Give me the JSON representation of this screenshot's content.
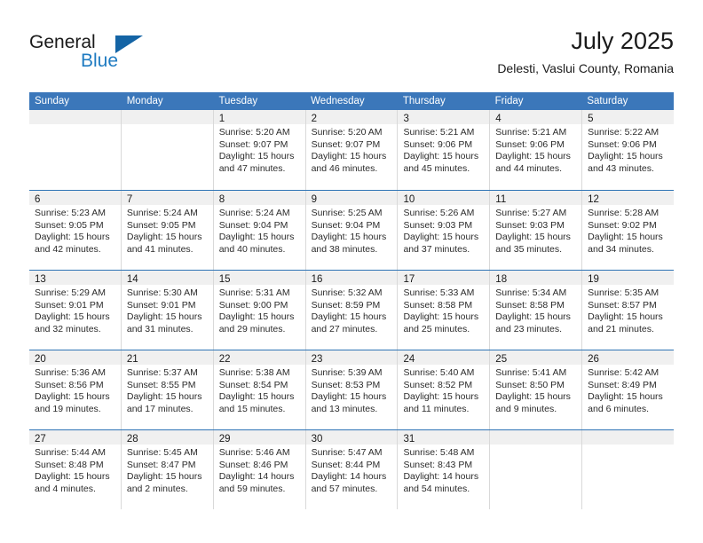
{
  "brand": {
    "name_part1": "General",
    "name_part2": "Blue",
    "logo_icon": "triangle-icon",
    "accent_blue": "#1f7bc1",
    "triangle_blue": "#1464a5"
  },
  "header": {
    "title": "July 2025",
    "subtitle": "Delesti, Vaslui County, Romania"
  },
  "calendar": {
    "header_bg": "#3b77ba",
    "row_separator_color": "#2f74b5",
    "day_band_bg": "#f0f0f0",
    "weekdays": [
      "Sunday",
      "Monday",
      "Tuesday",
      "Wednesday",
      "Thursday",
      "Friday",
      "Saturday"
    ],
    "weeks": [
      [
        {
          "day": "",
          "empty": true,
          "lines": []
        },
        {
          "day": "",
          "empty": true,
          "lines": []
        },
        {
          "day": "1",
          "empty": false,
          "lines": [
            "Sunrise: 5:20 AM",
            "Sunset: 9:07 PM",
            "Daylight: 15 hours",
            "and 47 minutes."
          ]
        },
        {
          "day": "2",
          "empty": false,
          "lines": [
            "Sunrise: 5:20 AM",
            "Sunset: 9:07 PM",
            "Daylight: 15 hours",
            "and 46 minutes."
          ]
        },
        {
          "day": "3",
          "empty": false,
          "lines": [
            "Sunrise: 5:21 AM",
            "Sunset: 9:06 PM",
            "Daylight: 15 hours",
            "and 45 minutes."
          ]
        },
        {
          "day": "4",
          "empty": false,
          "lines": [
            "Sunrise: 5:21 AM",
            "Sunset: 9:06 PM",
            "Daylight: 15 hours",
            "and 44 minutes."
          ]
        },
        {
          "day": "5",
          "empty": false,
          "lines": [
            "Sunrise: 5:22 AM",
            "Sunset: 9:06 PM",
            "Daylight: 15 hours",
            "and 43 minutes."
          ]
        }
      ],
      [
        {
          "day": "6",
          "empty": false,
          "lines": [
            "Sunrise: 5:23 AM",
            "Sunset: 9:05 PM",
            "Daylight: 15 hours",
            "and 42 minutes."
          ]
        },
        {
          "day": "7",
          "empty": false,
          "lines": [
            "Sunrise: 5:24 AM",
            "Sunset: 9:05 PM",
            "Daylight: 15 hours",
            "and 41 minutes."
          ]
        },
        {
          "day": "8",
          "empty": false,
          "lines": [
            "Sunrise: 5:24 AM",
            "Sunset: 9:04 PM",
            "Daylight: 15 hours",
            "and 40 minutes."
          ]
        },
        {
          "day": "9",
          "empty": false,
          "lines": [
            "Sunrise: 5:25 AM",
            "Sunset: 9:04 PM",
            "Daylight: 15 hours",
            "and 38 minutes."
          ]
        },
        {
          "day": "10",
          "empty": false,
          "lines": [
            "Sunrise: 5:26 AM",
            "Sunset: 9:03 PM",
            "Daylight: 15 hours",
            "and 37 minutes."
          ]
        },
        {
          "day": "11",
          "empty": false,
          "lines": [
            "Sunrise: 5:27 AM",
            "Sunset: 9:03 PM",
            "Daylight: 15 hours",
            "and 35 minutes."
          ]
        },
        {
          "day": "12",
          "empty": false,
          "lines": [
            "Sunrise: 5:28 AM",
            "Sunset: 9:02 PM",
            "Daylight: 15 hours",
            "and 34 minutes."
          ]
        }
      ],
      [
        {
          "day": "13",
          "empty": false,
          "lines": [
            "Sunrise: 5:29 AM",
            "Sunset: 9:01 PM",
            "Daylight: 15 hours",
            "and 32 minutes."
          ]
        },
        {
          "day": "14",
          "empty": false,
          "lines": [
            "Sunrise: 5:30 AM",
            "Sunset: 9:01 PM",
            "Daylight: 15 hours",
            "and 31 minutes."
          ]
        },
        {
          "day": "15",
          "empty": false,
          "lines": [
            "Sunrise: 5:31 AM",
            "Sunset: 9:00 PM",
            "Daylight: 15 hours",
            "and 29 minutes."
          ]
        },
        {
          "day": "16",
          "empty": false,
          "lines": [
            "Sunrise: 5:32 AM",
            "Sunset: 8:59 PM",
            "Daylight: 15 hours",
            "and 27 minutes."
          ]
        },
        {
          "day": "17",
          "empty": false,
          "lines": [
            "Sunrise: 5:33 AM",
            "Sunset: 8:58 PM",
            "Daylight: 15 hours",
            "and 25 minutes."
          ]
        },
        {
          "day": "18",
          "empty": false,
          "lines": [
            "Sunrise: 5:34 AM",
            "Sunset: 8:58 PM",
            "Daylight: 15 hours",
            "and 23 minutes."
          ]
        },
        {
          "day": "19",
          "empty": false,
          "lines": [
            "Sunrise: 5:35 AM",
            "Sunset: 8:57 PM",
            "Daylight: 15 hours",
            "and 21 minutes."
          ]
        }
      ],
      [
        {
          "day": "20",
          "empty": false,
          "lines": [
            "Sunrise: 5:36 AM",
            "Sunset: 8:56 PM",
            "Daylight: 15 hours",
            "and 19 minutes."
          ]
        },
        {
          "day": "21",
          "empty": false,
          "lines": [
            "Sunrise: 5:37 AM",
            "Sunset: 8:55 PM",
            "Daylight: 15 hours",
            "and 17 minutes."
          ]
        },
        {
          "day": "22",
          "empty": false,
          "lines": [
            "Sunrise: 5:38 AM",
            "Sunset: 8:54 PM",
            "Daylight: 15 hours",
            "and 15 minutes."
          ]
        },
        {
          "day": "23",
          "empty": false,
          "lines": [
            "Sunrise: 5:39 AM",
            "Sunset: 8:53 PM",
            "Daylight: 15 hours",
            "and 13 minutes."
          ]
        },
        {
          "day": "24",
          "empty": false,
          "lines": [
            "Sunrise: 5:40 AM",
            "Sunset: 8:52 PM",
            "Daylight: 15 hours",
            "and 11 minutes."
          ]
        },
        {
          "day": "25",
          "empty": false,
          "lines": [
            "Sunrise: 5:41 AM",
            "Sunset: 8:50 PM",
            "Daylight: 15 hours",
            "and 9 minutes."
          ]
        },
        {
          "day": "26",
          "empty": false,
          "lines": [
            "Sunrise: 5:42 AM",
            "Sunset: 8:49 PM",
            "Daylight: 15 hours",
            "and 6 minutes."
          ]
        }
      ],
      [
        {
          "day": "27",
          "empty": false,
          "lines": [
            "Sunrise: 5:44 AM",
            "Sunset: 8:48 PM",
            "Daylight: 15 hours",
            "and 4 minutes."
          ]
        },
        {
          "day": "28",
          "empty": false,
          "lines": [
            "Sunrise: 5:45 AM",
            "Sunset: 8:47 PM",
            "Daylight: 15 hours",
            "and 2 minutes."
          ]
        },
        {
          "day": "29",
          "empty": false,
          "lines": [
            "Sunrise: 5:46 AM",
            "Sunset: 8:46 PM",
            "Daylight: 14 hours",
            "and 59 minutes."
          ]
        },
        {
          "day": "30",
          "empty": false,
          "lines": [
            "Sunrise: 5:47 AM",
            "Sunset: 8:44 PM",
            "Daylight: 14 hours",
            "and 57 minutes."
          ]
        },
        {
          "day": "31",
          "empty": false,
          "lines": [
            "Sunrise: 5:48 AM",
            "Sunset: 8:43 PM",
            "Daylight: 14 hours",
            "and 54 minutes."
          ]
        },
        {
          "day": "",
          "empty": true,
          "lines": []
        },
        {
          "day": "",
          "empty": true,
          "lines": []
        }
      ]
    ]
  }
}
